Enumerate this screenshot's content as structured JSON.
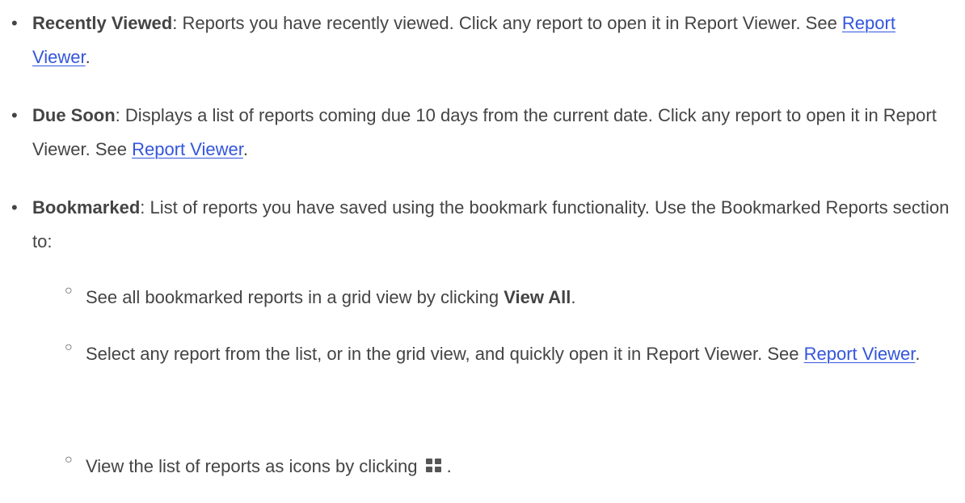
{
  "bullets": {
    "recently_viewed": {
      "term": "Recently Viewed",
      "text_before_link": ": Reports you have recently viewed. Click any report to open it in Report Viewer. See ",
      "link": "Report Viewer",
      "text_after_link": "."
    },
    "due_soon": {
      "term": "Due Soon",
      "text_before_link": ": Displays a list of reports coming due 10 days from the current date. Click any report to open it in Report Viewer. See ",
      "link": "Report Viewer",
      "text_after_link": "."
    },
    "bookmarked": {
      "term": "Bookmarked",
      "text": ": List of reports you have saved using the bookmark functionality. Use the Bookmarked Reports section to:"
    }
  },
  "sub_bullets": {
    "view_all": {
      "text_before": "See all bookmarked reports in a grid view by clicking ",
      "bold": "View All",
      "text_after": "."
    },
    "select_report": {
      "text_before_link": "Select any report from the list, or in the grid view, and quickly open it in Report Viewer. See ",
      "link": "Report Viewer",
      "text_after_link": "."
    },
    "view_icons": {
      "text_before": "View the list of reports as icons by clicking ",
      "icon": "grid-view-icon",
      "text_after": " ."
    }
  },
  "markers": {
    "bullet": "•",
    "sub_bullet": "○"
  }
}
